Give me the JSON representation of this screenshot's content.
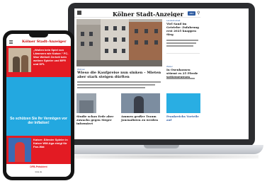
{
  "desktop": {
    "site_title": "Kölner Stadt-Anzeiger",
    "abo_label": "ABO",
    "hero": {
      "kicker": "Wohnen",
      "headline": "Wieso die Kaufpreise nun sinken – Mieten aber stark steigen dürften"
    },
    "sidebar": [
      {
        "kicker": "Landwirtschaft",
        "headline": "Viel Sand im Getriebe: Zufahrung erst 2025 knappen Sieg"
      },
      {
        "kicker": "Wetter",
        "headline": "In Oxenhausen stürmt es 25 Pferde weitergewesen"
      }
    ],
    "cards": [
      {
        "headline": "Studie schau Erde aber zuwachs gegen Sieger informiert"
      },
      {
        "headline": "Ammen großer Traum Journalisten zu werden"
      },
      {
        "headline": "Frankreichs Vorteile auf"
      }
    ]
  },
  "phone": {
    "logo": "Kölner Stadt-Anzeiger",
    "headline_1": "„Wollen kein Spiel von Lämmern wie Kaiser.“ FC-Woe Weibell Zerhelt kein weitere Spieler und BFR und DFL",
    "ad_text": "So schützen Sie Ihr Vermögen vor der Inflation!",
    "headline_2": "Kaiser: Ältester Spieler in Kaiser WM-Aga einigt für Fan-Wat",
    "bottom_text": "DFB-Präsident",
    "url": "ksta.de"
  },
  "colors": {
    "brand_red": "#e31b23",
    "ad_blue": "#23a8e0",
    "link_blue": "#2c5aa0"
  },
  "icons": {
    "menu": "hamburger-menu-icon",
    "search": "search-icon"
  }
}
